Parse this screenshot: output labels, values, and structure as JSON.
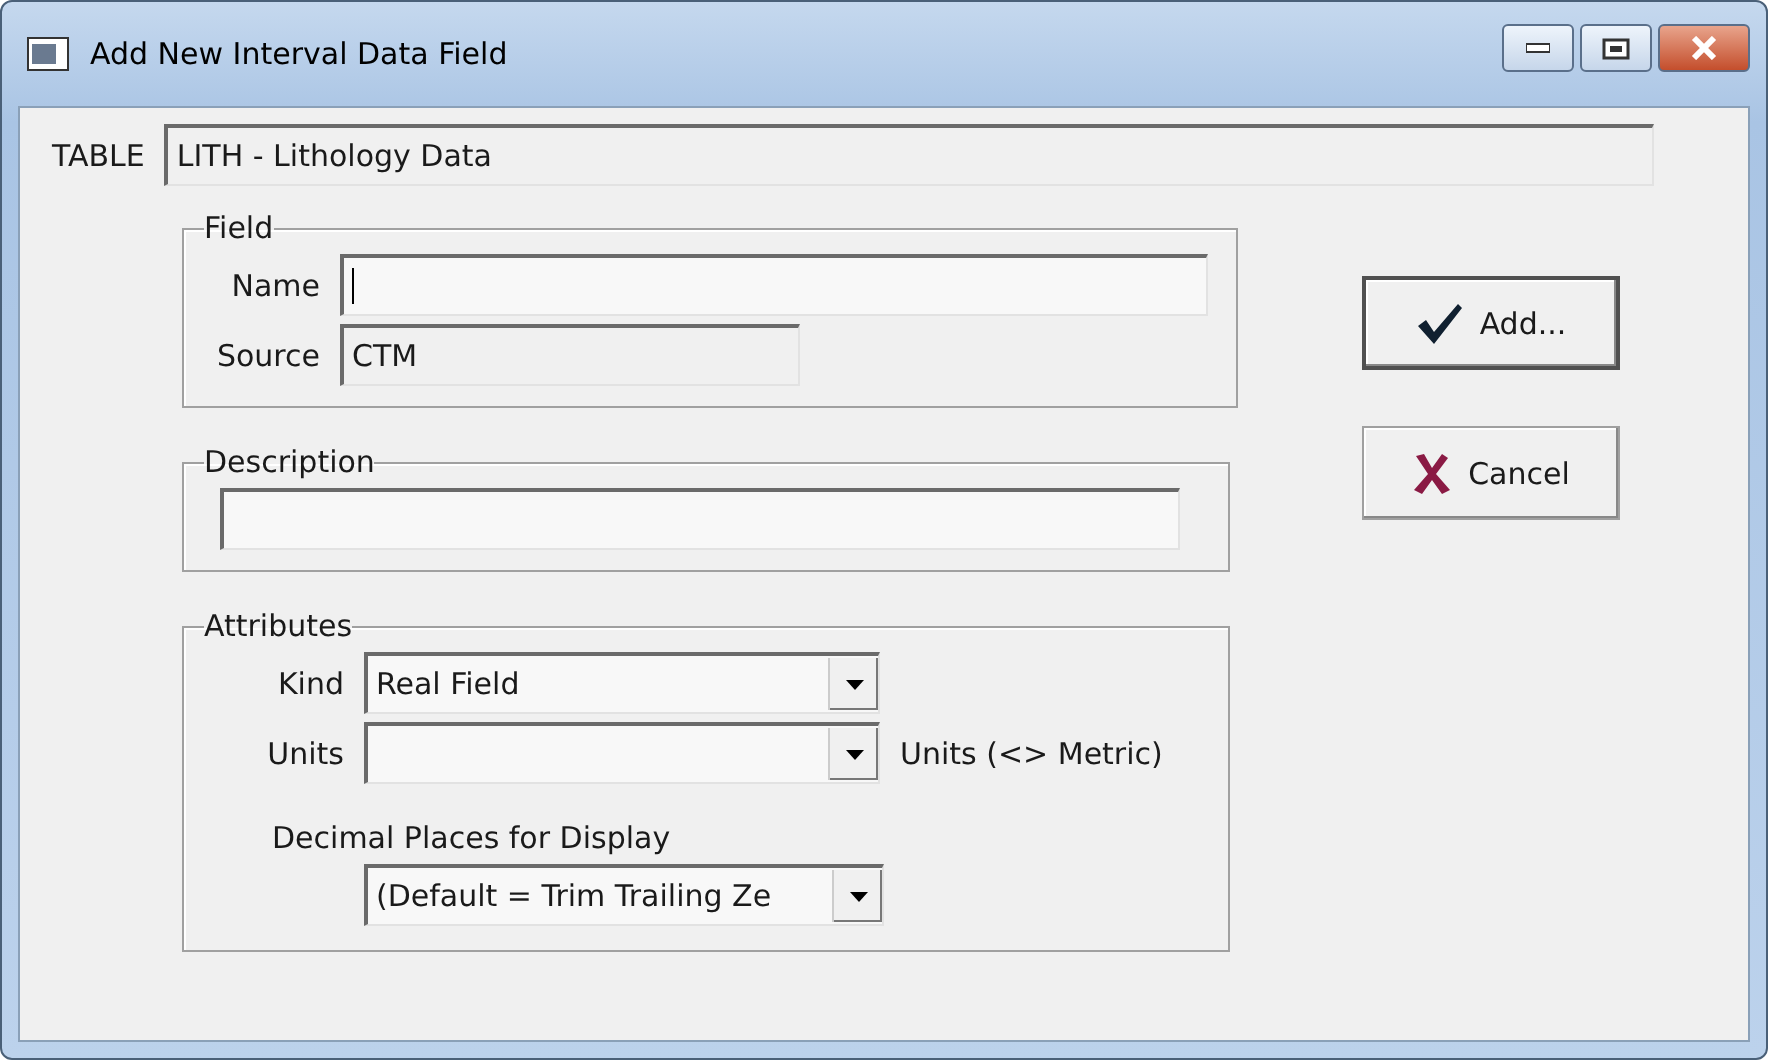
{
  "window": {
    "title": "Add New Interval Data Field"
  },
  "table": {
    "label": "TABLE",
    "value": "LITH - Lithology Data"
  },
  "field_group": {
    "title": "Field",
    "name": {
      "label": "Name",
      "focused": true
    },
    "source": {
      "label": "Source",
      "value": "CTM"
    }
  },
  "description_group": {
    "title": "Description"
  },
  "attributes": {
    "title": "Attributes",
    "kind": {
      "label": "Kind",
      "value": "Real Field"
    },
    "units": {
      "label": "Units",
      "suffix": "Units (<> Metric)"
    },
    "decimal": {
      "label": "Decimal Places for Display",
      "value": "(Default = Trim Trailing Ze"
    }
  },
  "buttons": [
    {
      "label": "Add...",
      "kind": "add",
      "default": true
    },
    {
      "label": "Cancel",
      "kind": "cancel",
      "default": false
    }
  ]
}
